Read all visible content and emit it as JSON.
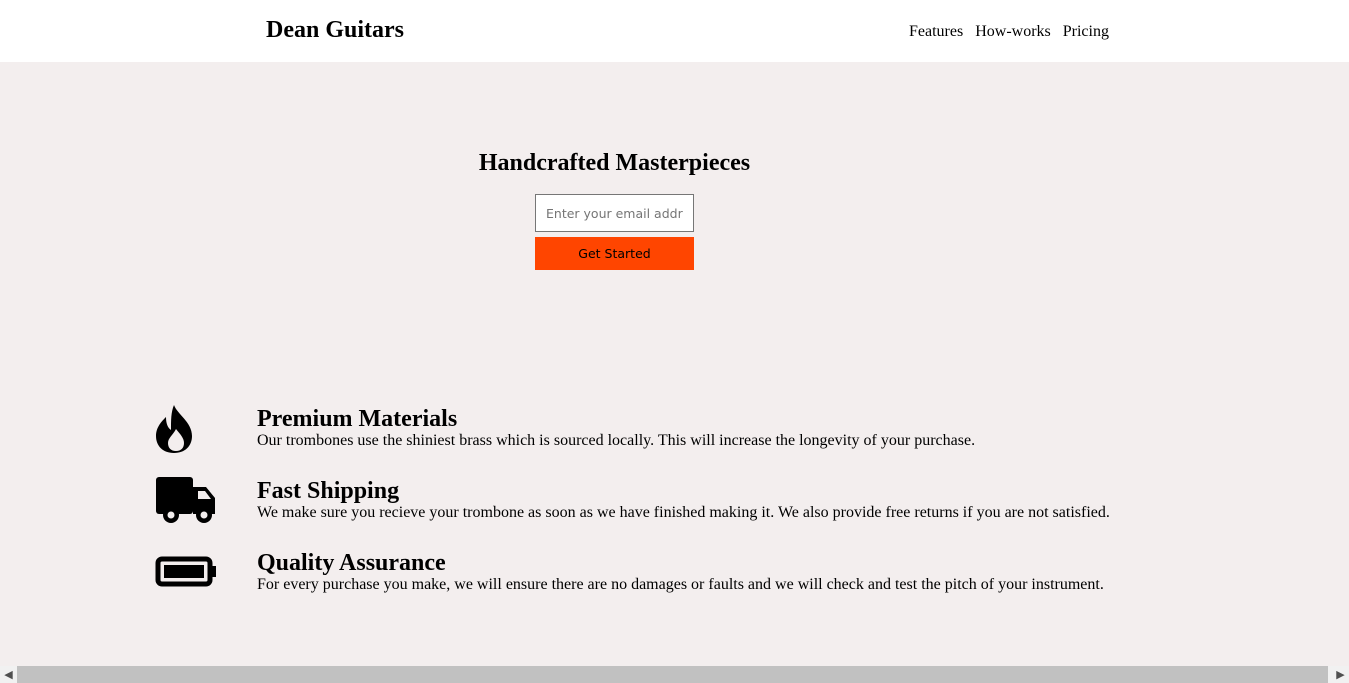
{
  "header": {
    "logo": "Dean Guitars",
    "nav": [
      "Features",
      "How-works",
      "Pricing"
    ]
  },
  "hero": {
    "title": "Handcrafted Masterpieces",
    "email_placeholder": "Enter your email address",
    "button_label": "Get Started",
    "button_color": "#ff4500"
  },
  "features": [
    {
      "icon": "fire-icon",
      "title": "Premium Materials",
      "text": "Our trombones use the shiniest brass which is sourced locally. This will increase the longevity of your purchase."
    },
    {
      "icon": "truck-icon",
      "title": "Fast Shipping",
      "text": "We make sure you recieve your trombone as soon as we have finished making it. We also provide free returns if you are not satisfied."
    },
    {
      "icon": "battery-full-icon",
      "title": "Quality Assurance",
      "text": "For every purchase you make, we will ensure there are no damages or faults and we will check and test the pitch of your instrument."
    }
  ],
  "colors": {
    "page_background": "#f3eeee",
    "header_background": "#ffffff",
    "accent": "#ff4500"
  }
}
